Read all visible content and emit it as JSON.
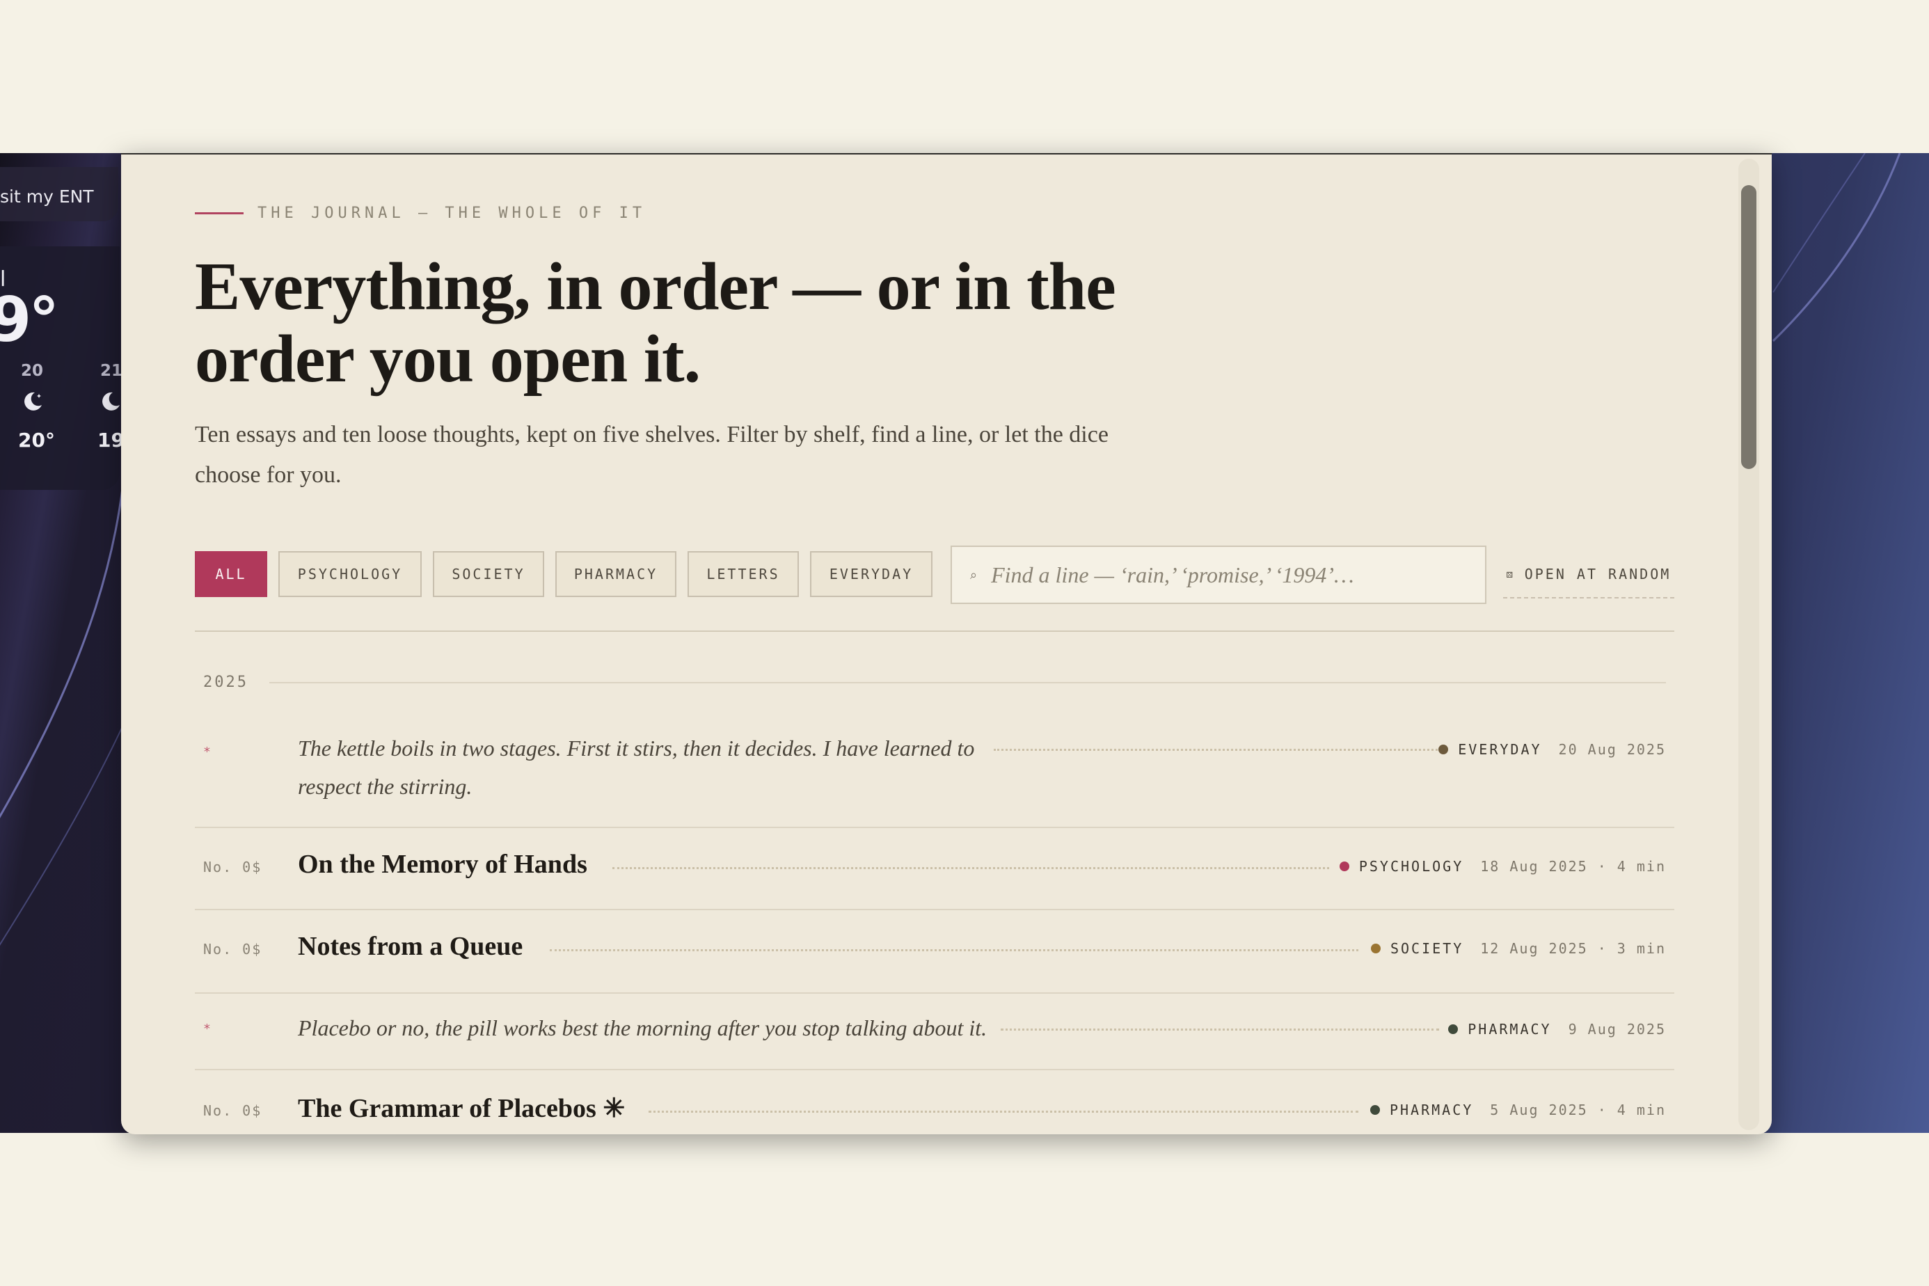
{
  "desktop": {
    "chip_text": "sit my ENT",
    "weather": {
      "city": "l",
      "temp": "9°",
      "hours": [
        {
          "hour": "20",
          "temp": "20°"
        },
        {
          "hour": "21",
          "temp": "19"
        }
      ]
    }
  },
  "page": {
    "eyebrow": "THE JOURNAL — THE WHOLE OF IT",
    "title": "Everything, in order — or in the order you open it.",
    "lede": "Ten essays and ten loose thoughts, kept on five shelves. Filter by shelf, find a line, or let the dice choose for you."
  },
  "filters": {
    "chips": [
      "ALL",
      "PSYCHOLOGY",
      "SOCIETY",
      "PHARMACY",
      "LETTERS",
      "EVERYDAY"
    ],
    "active": "ALL",
    "search_placeholder": "Find a line — ‘rain,’ ‘promise,’ ‘1994’…",
    "random_label": "OPEN AT RANDOM",
    "search_icon": "search-icon",
    "dice_icon": "dice-icon"
  },
  "year_label": "2025",
  "entries": [
    {
      "kind": "thought",
      "mark": "*",
      "text": "The kettle boils in two stages. First it stirs, then it decides. I have learned to respect the stirring.",
      "shelf": "EVERYDAY",
      "shelf_color": "#6d5a3c",
      "date": "20 Aug 2025",
      "read": ""
    },
    {
      "kind": "essay",
      "mark": "No. 0$",
      "text": "On the Memory of Hands",
      "shelf": "PSYCHOLOGY",
      "shelf_color": "#b0395b",
      "date": "18 Aug 2025",
      "read": "· 4 min"
    },
    {
      "kind": "essay",
      "mark": "No. 0$",
      "text": "Notes from a Queue",
      "shelf": "SOCIETY",
      "shelf_color": "#9a7431",
      "date": "12 Aug 2025",
      "read": "· 3 min"
    },
    {
      "kind": "thought",
      "mark": "*",
      "text": "Placebo or no, the pill works best the morning after you stop talking about it.",
      "shelf": "PHARMACY",
      "shelf_color": "#3f4a3b",
      "date": "9 Aug 2025",
      "read": ""
    },
    {
      "kind": "essay",
      "mark": "No. 0$",
      "text": "The Grammar of Placebos ✳",
      "shelf": "PHARMACY",
      "shelf_color": "#3f4a3b",
      "date": "5 Aug 2025",
      "read": "· 4 min"
    }
  ]
}
